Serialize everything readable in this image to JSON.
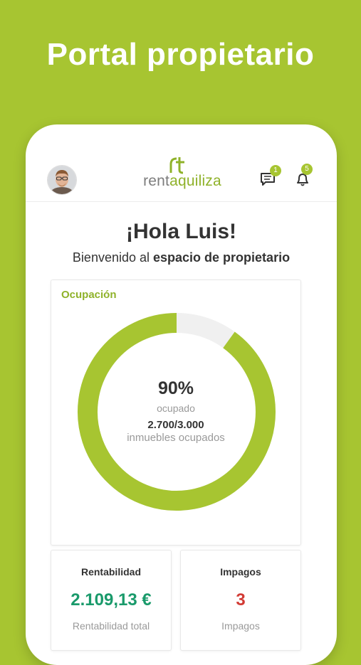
{
  "promo": {
    "title": "Portal propietario"
  },
  "header": {
    "logo_part1": "rent",
    "logo_part2": "aquiliza",
    "messages_count": "1",
    "notifications_count": "5"
  },
  "greeting": {
    "title": "¡Hola Luis!",
    "welcome_prefix": "Bienvenido al ",
    "welcome_bold": "espacio de propietario"
  },
  "occupancy": {
    "title": "Ocupación",
    "percent": 90,
    "percent_text": "90%",
    "percent_label": "ocupado",
    "count_text": "2.700/3.000",
    "count_label": "inmuebles ocupados"
  },
  "rentabilidad": {
    "title": "Rentabilidad",
    "value": "2.109,13 €",
    "sub": "Rentabilidad total"
  },
  "impagos": {
    "title": "Impagos",
    "value": "3",
    "sub": "Impagos"
  },
  "colors": {
    "brand_green": "#a7c531",
    "value_green": "#1a9a6b",
    "value_red": "#d23b35",
    "donut_track": "#f0f0f0"
  },
  "icons": {
    "messages": "chat-bubble-icon",
    "notifications": "bell-icon",
    "logo_mark": "rt-logo-icon"
  }
}
